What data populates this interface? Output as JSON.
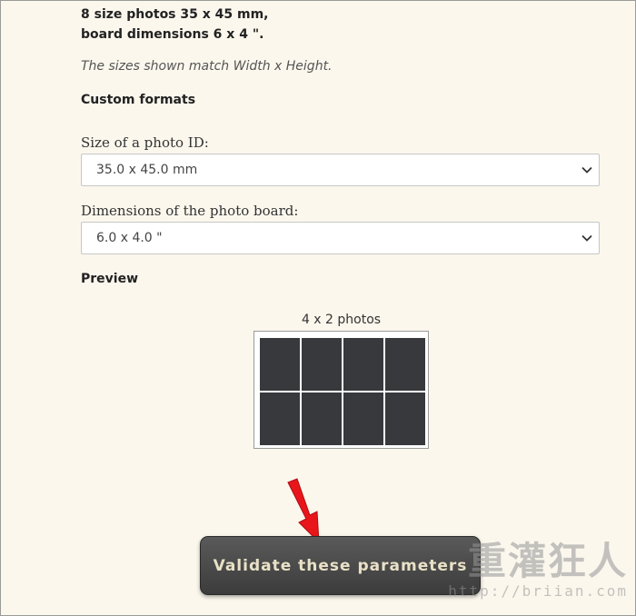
{
  "summary": {
    "line1": "8 size photos 35 x 45 mm,",
    "line2": "board dimensions 6 x 4 \"."
  },
  "note": "The sizes shown match Width x Height.",
  "custom_formats": {
    "heading": "Custom formats"
  },
  "photo_size": {
    "label": "Size of a photo ID:",
    "value": "35.0 x 45.0 mm"
  },
  "board_size": {
    "label": "Dimensions of the photo board:",
    "value": "6.0 x 4.0 \""
  },
  "preview": {
    "heading": "Preview",
    "caption": "4 x 2 photos",
    "columns": 4,
    "rows": 2,
    "photo_color": "#37393d"
  },
  "validate_button": {
    "label": "Validate these parameters"
  },
  "watermark": {
    "text": "重灌狂人",
    "url": "http://briian.com"
  },
  "colors": {
    "page_bg": "#fbf7ed",
    "button_bg": "#444444",
    "button_text": "#e9e1c7",
    "arrow": "#e8161b"
  }
}
